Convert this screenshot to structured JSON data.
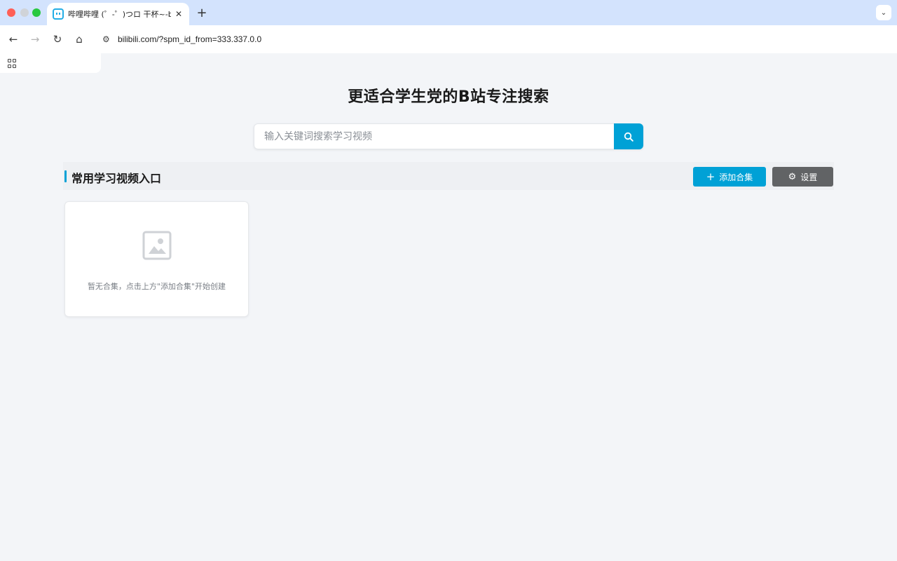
{
  "browser": {
    "tab_title": "哔哩哔哩 (゜-゜)つロ 干杯~-bilibili",
    "tab_close": "✕",
    "new_tab": "+",
    "tab_menu": "⌄",
    "url": "bilibili.com/?spm_id_from=333.337.0.0",
    "nav": {
      "back": "←",
      "forward": "→",
      "reload": "↻",
      "home": "⌂"
    },
    "site_info_icon": "⚙"
  },
  "page": {
    "title": "更适合学生党的B站专注搜索",
    "search": {
      "placeholder": "输入关键词搜索学习视频",
      "value": ""
    },
    "section": {
      "title": "常用学习视频入口",
      "add_label": "添加合集",
      "add_icon": "+",
      "settings_label": "设置",
      "settings_icon": "⚙"
    },
    "empty_state": {
      "text": "暂无合集，点击上方\"添加合集\"开始创建"
    }
  },
  "colors": {
    "accent": "#00a1d6",
    "settings_button": "#616365",
    "tabbar": "#d3e3fd",
    "background": "#f3f5f8"
  }
}
